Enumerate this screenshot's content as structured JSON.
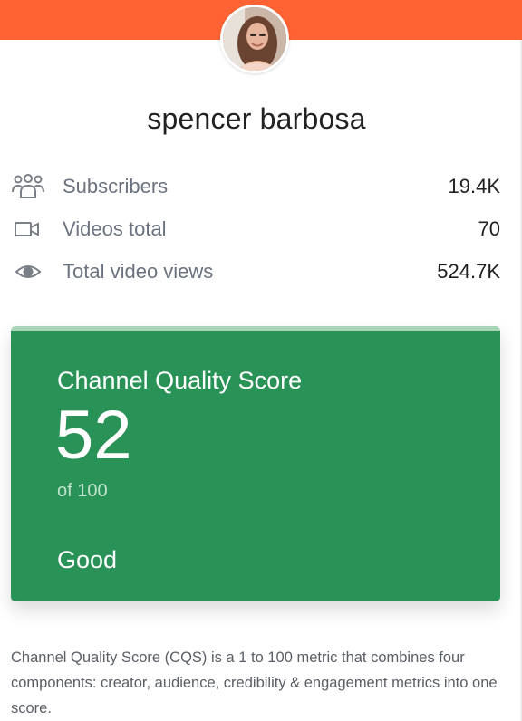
{
  "header": {
    "banner_color": "#ff6333",
    "avatar_icon": "profile-photo"
  },
  "channel": {
    "name": "spencer barbosa"
  },
  "stats": [
    {
      "icon": "users-icon",
      "label": "Subscribers",
      "value": "19.4K"
    },
    {
      "icon": "video-camera-icon",
      "label": "Videos total",
      "value": "70"
    },
    {
      "icon": "eye-icon",
      "label": "Total video views",
      "value": "524.7K"
    }
  ],
  "cqs": {
    "title": "Channel Quality Score",
    "score": "52",
    "max_label": "of 100",
    "rating": "Good",
    "card_color": "#299257",
    "description": "Channel Quality Score (CQS) is a 1 to 100 metric that combines four components: creator, audience, credibility & engagement metrics into one score."
  }
}
